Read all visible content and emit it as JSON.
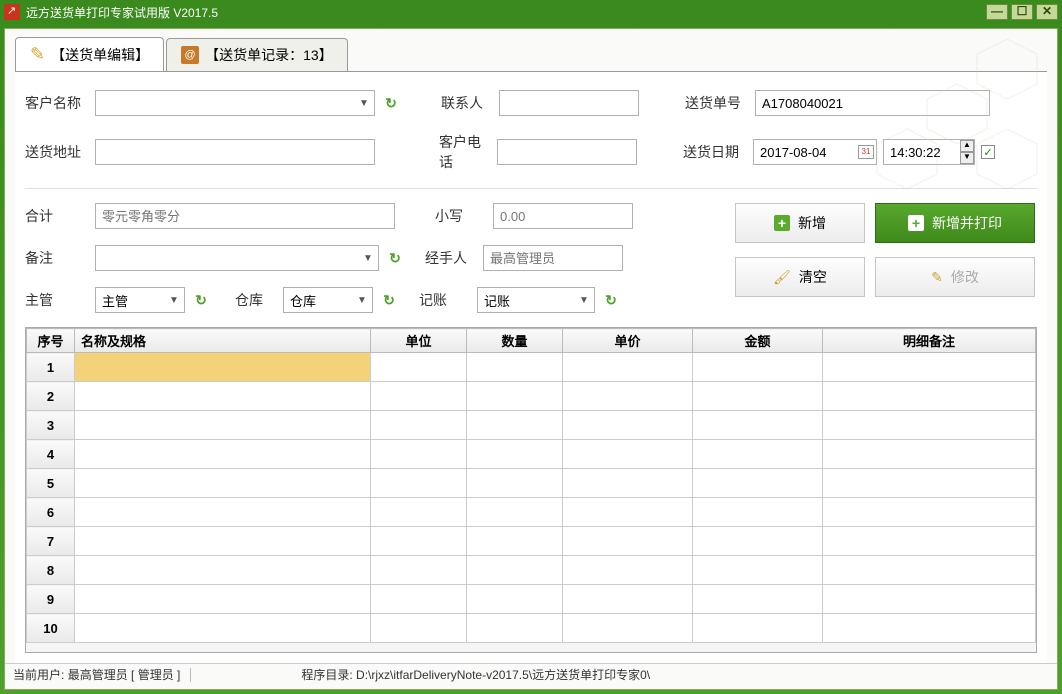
{
  "window": {
    "title": "远方送货单打印专家试用版 V2017.5"
  },
  "tabs": {
    "edit": "【送货单编辑】",
    "records": "【送货单记录：13】"
  },
  "labels": {
    "customerName": "客户名称",
    "deliveryAddr": "送货地址",
    "contact": "联系人",
    "custPhone": "客户电话",
    "deliveryNo": "送货单号",
    "deliveryDate": "送货日期",
    "total": "合计",
    "remark": "备注",
    "supervisor": "主管",
    "warehouse": "仓库",
    "lowercase": "小写",
    "handler": "经手人",
    "accounting": "记账"
  },
  "values": {
    "deliveryNo": "A1708040021",
    "date": "2017-08-04",
    "time": "14:30:22",
    "totalPlaceholder": "零元零角零分",
    "lowercasePlaceholder": "0.00",
    "handlerPlaceholder": "最高管理员",
    "supervisor": "主管",
    "warehouse": "仓库",
    "accounting": "记账",
    "checked": "✓"
  },
  "buttons": {
    "add": "新增",
    "addPrint": "新增并打印",
    "clear": "清空",
    "modify": "修改"
  },
  "table": {
    "headers": [
      "序号",
      "名称及规格",
      "单位",
      "数量",
      "单价",
      "金额",
      "明细备注"
    ],
    "rows": [
      "1",
      "2",
      "3",
      "4",
      "5",
      "6",
      "7",
      "8",
      "9",
      "10"
    ]
  },
  "status": {
    "userLabel": "当前用户:",
    "userValue": "最高管理员 [ 管理员 ]",
    "dirLabel": "程序目录:",
    "dirValue": "D:\\rjxz\\itfarDeliveryNote-v2017.5\\远方送货单打印专家0\\"
  }
}
